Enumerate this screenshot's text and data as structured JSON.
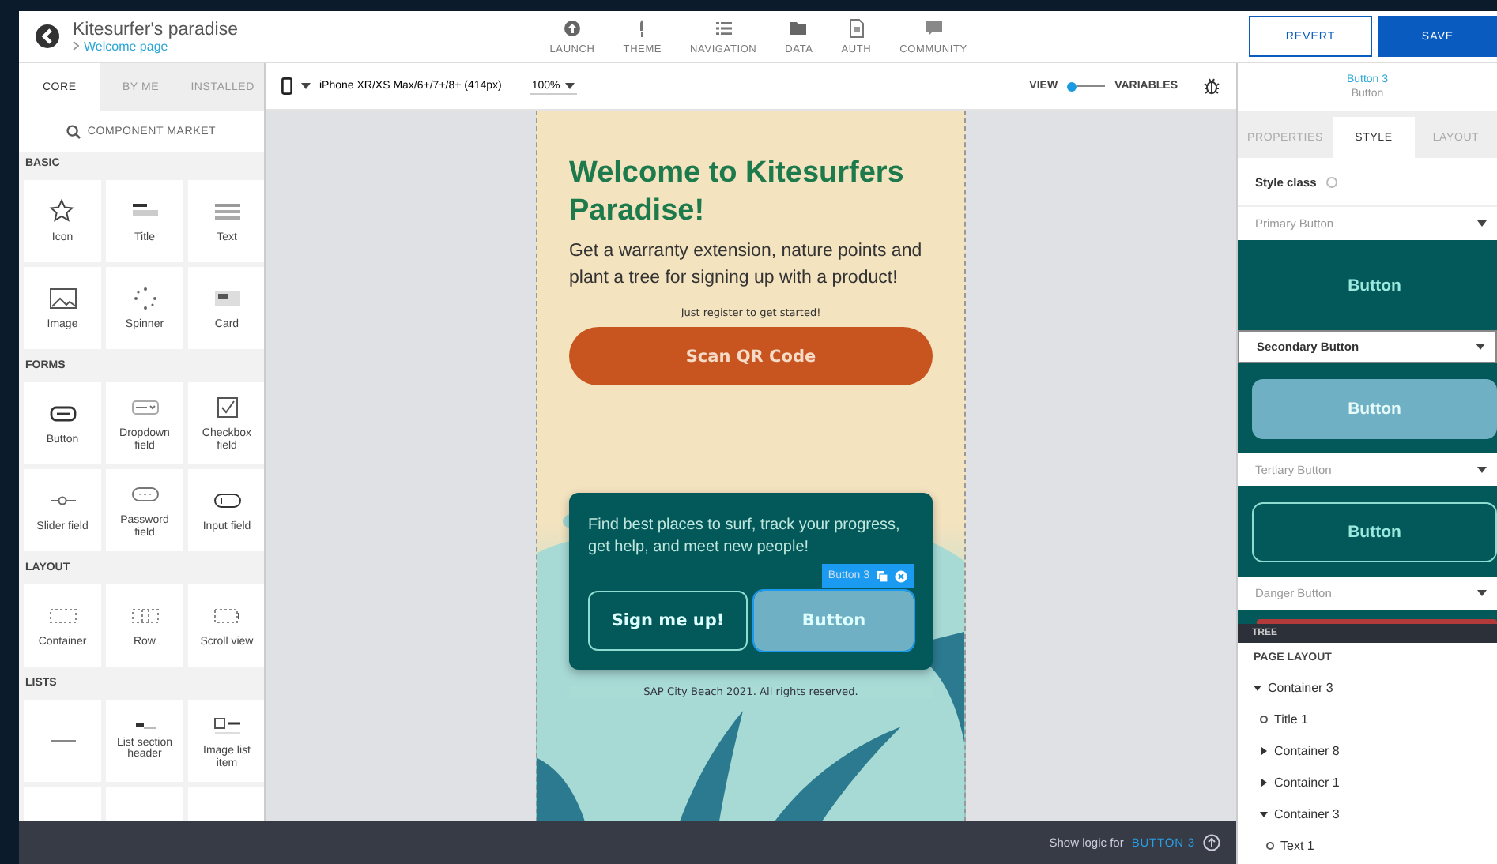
{
  "app": {
    "title": "Kitesurfer's paradise",
    "page": "Welcome page"
  },
  "nav": [
    {
      "label": "LAUNCH",
      "kind": "launch"
    },
    {
      "label": "THEME",
      "kind": "theme"
    },
    {
      "label": "NAVIGATION",
      "kind": "navigation"
    },
    {
      "label": "DATA",
      "kind": "data"
    },
    {
      "label": "AUTH",
      "kind": "auth"
    },
    {
      "label": "COMMUNITY",
      "kind": "community"
    }
  ],
  "actions": [
    {
      "label": "REVERT",
      "kind": "secondary"
    },
    {
      "label": "SAVE",
      "kind": "primary"
    }
  ],
  "left_tabs": [
    {
      "label": "CORE",
      "selected": true
    },
    {
      "label": "BY ME",
      "selected": false
    },
    {
      "label": "INSTALLED",
      "selected": false
    }
  ],
  "component_market": "COMPONENT MARKET",
  "sections": [
    {
      "title": "BASIC",
      "items": [
        {
          "label": "Icon",
          "kind": "star"
        },
        {
          "label": "Title",
          "kind": "title"
        },
        {
          "label": "Text",
          "kind": "text"
        },
        {
          "label": "Image",
          "kind": "image"
        },
        {
          "label": "Spinner",
          "kind": "spinner"
        },
        {
          "label": "Card",
          "kind": "card"
        }
      ]
    },
    {
      "title": "FORMS",
      "items": [
        {
          "label": "Button",
          "kind": "button"
        },
        {
          "label": "Dropdown field",
          "kind": "dropdown"
        },
        {
          "label": "Checkbox field",
          "kind": "checkbox"
        },
        {
          "label": "Slider field",
          "kind": "slider"
        },
        {
          "label": "Password field",
          "kind": "password"
        },
        {
          "label": "Input field",
          "kind": "input"
        }
      ]
    },
    {
      "title": "LAYOUT",
      "items": [
        {
          "label": "Container",
          "kind": "container"
        },
        {
          "label": "Row",
          "kind": "row"
        },
        {
          "label": "Scroll view",
          "kind": "scroll"
        }
      ]
    },
    {
      "title": "LISTS",
      "items": [
        {
          "kind": "divider"
        },
        {
          "label": "List section header",
          "kind": "header"
        },
        {
          "label": "Image list item",
          "kind": "imageitem"
        },
        {
          "kind": "blank"
        },
        {
          "kind": "blank"
        },
        {
          "kind": "blank"
        }
      ]
    }
  ],
  "toolbar": {
    "device": "iPhone XR/XS Max/6+/7+/8+ (414px)",
    "zoom": "100%",
    "view": "VIEW",
    "variables": "VARIABLES"
  },
  "phone": {
    "title": "Welcome to Kitesurfers Paradise!",
    "subtitle": "Get a warranty extension, nature points and plant a tree for signing up with a product!",
    "note": "Just register to get started!",
    "cta": "Scan QR Code",
    "card_text": "Find best places to surf, track your progress, get help, and meet new people!",
    "buttons": [
      {
        "label": "Sign me up!",
        "kind": "outline",
        "selected": false
      },
      {
        "label": "Button",
        "kind": "filled",
        "selected": true
      }
    ],
    "selection_tag": "Button 3",
    "footer": "SAP City Beach 2021. All rights reserved."
  },
  "bottom": {
    "label": "Show logic for",
    "target": "BUTTON 3"
  },
  "selection": {
    "name": "Button 3",
    "type": "Button"
  },
  "right_tabs": [
    {
      "label": "PROPERTIES",
      "selected": false
    },
    {
      "label": "STYLE",
      "selected": true
    },
    {
      "label": "LAYOUT",
      "selected": false
    }
  ],
  "style_class": {
    "label": "Style class",
    "options": [
      {
        "label": "Primary Button",
        "kind": "primary",
        "selected": false,
        "preview": "Button"
      },
      {
        "label": "Secondary Button",
        "kind": "secondary",
        "selected": true,
        "preview": "Button"
      },
      {
        "label": "Tertiary Button",
        "kind": "tertiary",
        "selected": false,
        "preview": "Button"
      },
      {
        "label": "Danger Button",
        "kind": "danger",
        "selected": false
      }
    ]
  },
  "tree": {
    "title": "TREE",
    "heading": "PAGE LAYOUT",
    "items": [
      {
        "label": "Container 3",
        "expanded": true,
        "children": [
          {
            "label": "Title 1"
          },
          {
            "label": "Container 8",
            "expanded": false
          },
          {
            "label": "Container 1",
            "expanded": false
          },
          {
            "label": "Container 3",
            "expanded": true,
            "children": [
              {
                "label": "Text 1"
              }
            ]
          }
        ]
      }
    ]
  }
}
